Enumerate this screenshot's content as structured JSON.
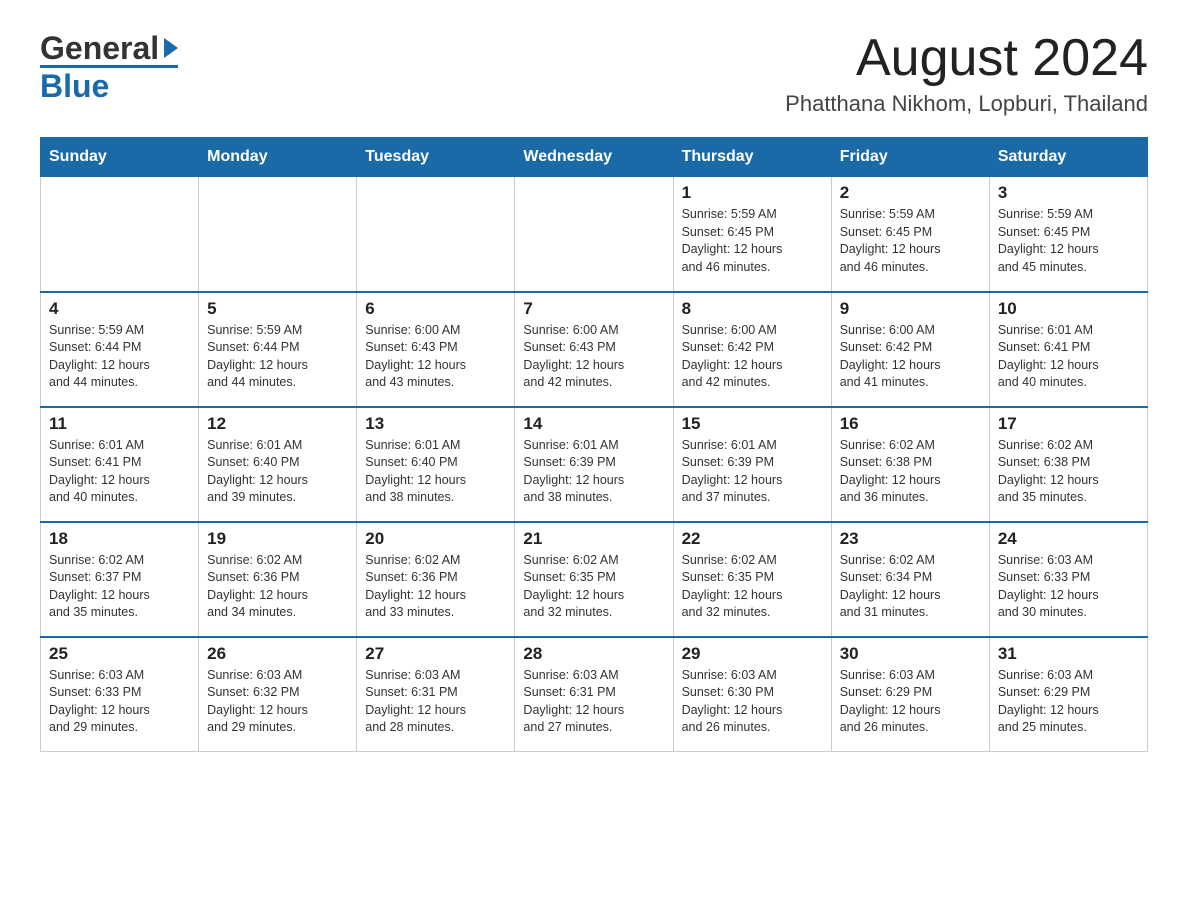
{
  "header": {
    "month_title": "August 2024",
    "subtitle": "Phatthana Nikhom, Lopburi, Thailand",
    "logo_line1": "General",
    "logo_line2": "Blue"
  },
  "days_of_week": [
    "Sunday",
    "Monday",
    "Tuesday",
    "Wednesday",
    "Thursday",
    "Friday",
    "Saturday"
  ],
  "weeks": [
    [
      {
        "day": "",
        "info": ""
      },
      {
        "day": "",
        "info": ""
      },
      {
        "day": "",
        "info": ""
      },
      {
        "day": "",
        "info": ""
      },
      {
        "day": "1",
        "info": "Sunrise: 5:59 AM\nSunset: 6:45 PM\nDaylight: 12 hours\nand 46 minutes."
      },
      {
        "day": "2",
        "info": "Sunrise: 5:59 AM\nSunset: 6:45 PM\nDaylight: 12 hours\nand 46 minutes."
      },
      {
        "day": "3",
        "info": "Sunrise: 5:59 AM\nSunset: 6:45 PM\nDaylight: 12 hours\nand 45 minutes."
      }
    ],
    [
      {
        "day": "4",
        "info": "Sunrise: 5:59 AM\nSunset: 6:44 PM\nDaylight: 12 hours\nand 44 minutes."
      },
      {
        "day": "5",
        "info": "Sunrise: 5:59 AM\nSunset: 6:44 PM\nDaylight: 12 hours\nand 44 minutes."
      },
      {
        "day": "6",
        "info": "Sunrise: 6:00 AM\nSunset: 6:43 PM\nDaylight: 12 hours\nand 43 minutes."
      },
      {
        "day": "7",
        "info": "Sunrise: 6:00 AM\nSunset: 6:43 PM\nDaylight: 12 hours\nand 42 minutes."
      },
      {
        "day": "8",
        "info": "Sunrise: 6:00 AM\nSunset: 6:42 PM\nDaylight: 12 hours\nand 42 minutes."
      },
      {
        "day": "9",
        "info": "Sunrise: 6:00 AM\nSunset: 6:42 PM\nDaylight: 12 hours\nand 41 minutes."
      },
      {
        "day": "10",
        "info": "Sunrise: 6:01 AM\nSunset: 6:41 PM\nDaylight: 12 hours\nand 40 minutes."
      }
    ],
    [
      {
        "day": "11",
        "info": "Sunrise: 6:01 AM\nSunset: 6:41 PM\nDaylight: 12 hours\nand 40 minutes."
      },
      {
        "day": "12",
        "info": "Sunrise: 6:01 AM\nSunset: 6:40 PM\nDaylight: 12 hours\nand 39 minutes."
      },
      {
        "day": "13",
        "info": "Sunrise: 6:01 AM\nSunset: 6:40 PM\nDaylight: 12 hours\nand 38 minutes."
      },
      {
        "day": "14",
        "info": "Sunrise: 6:01 AM\nSunset: 6:39 PM\nDaylight: 12 hours\nand 38 minutes."
      },
      {
        "day": "15",
        "info": "Sunrise: 6:01 AM\nSunset: 6:39 PM\nDaylight: 12 hours\nand 37 minutes."
      },
      {
        "day": "16",
        "info": "Sunrise: 6:02 AM\nSunset: 6:38 PM\nDaylight: 12 hours\nand 36 minutes."
      },
      {
        "day": "17",
        "info": "Sunrise: 6:02 AM\nSunset: 6:38 PM\nDaylight: 12 hours\nand 35 minutes."
      }
    ],
    [
      {
        "day": "18",
        "info": "Sunrise: 6:02 AM\nSunset: 6:37 PM\nDaylight: 12 hours\nand 35 minutes."
      },
      {
        "day": "19",
        "info": "Sunrise: 6:02 AM\nSunset: 6:36 PM\nDaylight: 12 hours\nand 34 minutes."
      },
      {
        "day": "20",
        "info": "Sunrise: 6:02 AM\nSunset: 6:36 PM\nDaylight: 12 hours\nand 33 minutes."
      },
      {
        "day": "21",
        "info": "Sunrise: 6:02 AM\nSunset: 6:35 PM\nDaylight: 12 hours\nand 32 minutes."
      },
      {
        "day": "22",
        "info": "Sunrise: 6:02 AM\nSunset: 6:35 PM\nDaylight: 12 hours\nand 32 minutes."
      },
      {
        "day": "23",
        "info": "Sunrise: 6:02 AM\nSunset: 6:34 PM\nDaylight: 12 hours\nand 31 minutes."
      },
      {
        "day": "24",
        "info": "Sunrise: 6:03 AM\nSunset: 6:33 PM\nDaylight: 12 hours\nand 30 minutes."
      }
    ],
    [
      {
        "day": "25",
        "info": "Sunrise: 6:03 AM\nSunset: 6:33 PM\nDaylight: 12 hours\nand 29 minutes."
      },
      {
        "day": "26",
        "info": "Sunrise: 6:03 AM\nSunset: 6:32 PM\nDaylight: 12 hours\nand 29 minutes."
      },
      {
        "day": "27",
        "info": "Sunrise: 6:03 AM\nSunset: 6:31 PM\nDaylight: 12 hours\nand 28 minutes."
      },
      {
        "day": "28",
        "info": "Sunrise: 6:03 AM\nSunset: 6:31 PM\nDaylight: 12 hours\nand 27 minutes."
      },
      {
        "day": "29",
        "info": "Sunrise: 6:03 AM\nSunset: 6:30 PM\nDaylight: 12 hours\nand 26 minutes."
      },
      {
        "day": "30",
        "info": "Sunrise: 6:03 AM\nSunset: 6:29 PM\nDaylight: 12 hours\nand 26 minutes."
      },
      {
        "day": "31",
        "info": "Sunrise: 6:03 AM\nSunset: 6:29 PM\nDaylight: 12 hours\nand 25 minutes."
      }
    ]
  ]
}
